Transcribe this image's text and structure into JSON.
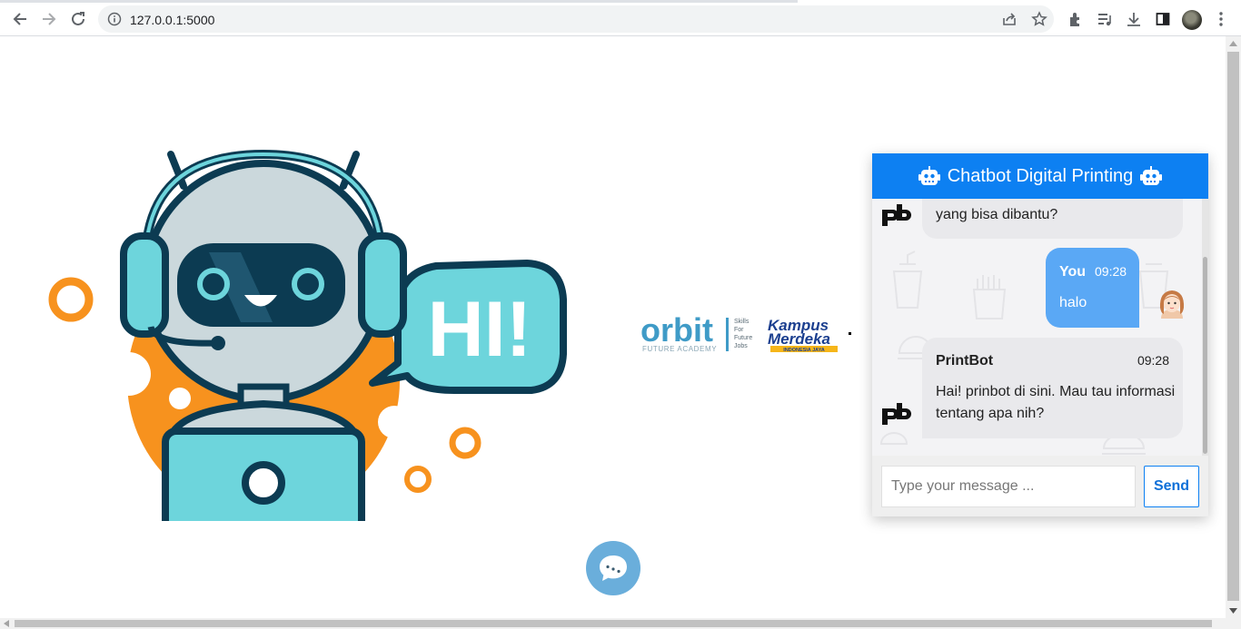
{
  "browser": {
    "url": "127.0.0.1:5000"
  },
  "chatbot": {
    "title": "Chatbot Digital Printing",
    "messages": [
      {
        "sender": "",
        "time": "",
        "text": "yang bisa dibantu?"
      },
      {
        "sender": "You",
        "time": "09:28",
        "text": "halo"
      },
      {
        "sender": "PrintBot",
        "time": "09:28",
        "text_line1": "Hai! prinbot di sini. Mau tau informasi",
        "text_line2": "tentang apa nih?"
      }
    ],
    "input": {
      "placeholder": "Type your message ...",
      "value": ""
    },
    "send_label": "Send"
  },
  "hero": {
    "speech_text": "HI!"
  },
  "partners": {
    "orbit_name": "orbit",
    "orbit_sub": "FUTURE ACADEMY",
    "orbit_tag1": "Skills",
    "orbit_tag2": "For",
    "orbit_tag3": "Future",
    "orbit_tag4": "Jobs",
    "km_line1": "Kampus",
    "km_line2": "Merdeka",
    "km_line3": "INDONESIA JAYA"
  },
  "colors": {
    "header": "#0d80f2",
    "user_bubble": "#5aa8f5",
    "bot_bubble": "#e9e9ec",
    "robot_teal": "#6dd5dc",
    "robot_navy": "#0c3b52",
    "accent_orange": "#f7921e",
    "toggle_button": "#6aaedb"
  },
  "icons": [
    "back-arrow-icon",
    "forward-arrow-icon",
    "reload-icon",
    "info-icon",
    "share-icon",
    "star-icon",
    "extensions-icon",
    "media-icon",
    "download-icon",
    "side-panel-icon",
    "menu-icon",
    "robot-icon",
    "chat-icon"
  ]
}
